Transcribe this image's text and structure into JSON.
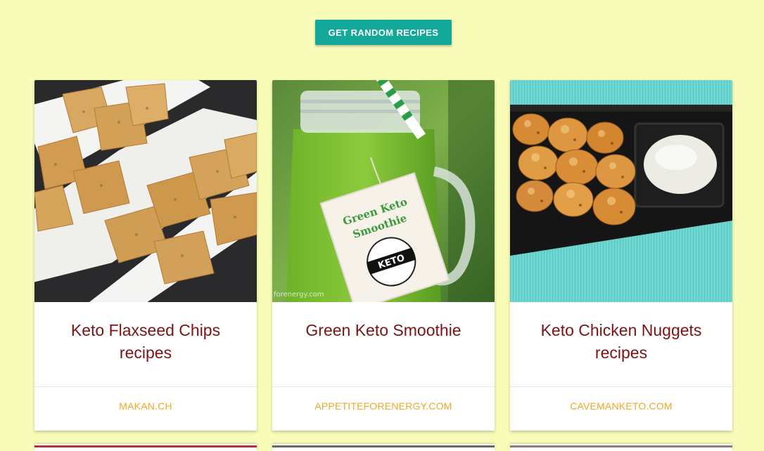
{
  "toolbar": {
    "random_button_label": "GET RANDOM RECIPES"
  },
  "recipes": [
    {
      "title": "Keto Flaxseed Chips recipes",
      "source": "MAKAN.CH",
      "image_icon": "flaxseed-chips-photo"
    },
    {
      "title": "Green Keto Smoothie",
      "source": "APPETITEFORENERGY.COM",
      "image_icon": "green-smoothie-photo",
      "image_tag_lines": [
        "Green Keto",
        "Smoothie"
      ],
      "image_badge": "KETO",
      "image_watermark": "forenergy.com"
    },
    {
      "title": "Keto Chicken Nuggets recipes",
      "source": "CAVEMANKETO.COM",
      "image_icon": "chicken-nuggets-photo"
    }
  ],
  "colors": {
    "background": "#f9fcb8",
    "button": "#14a89a",
    "title": "#7b1414",
    "source": "#f5a623"
  }
}
